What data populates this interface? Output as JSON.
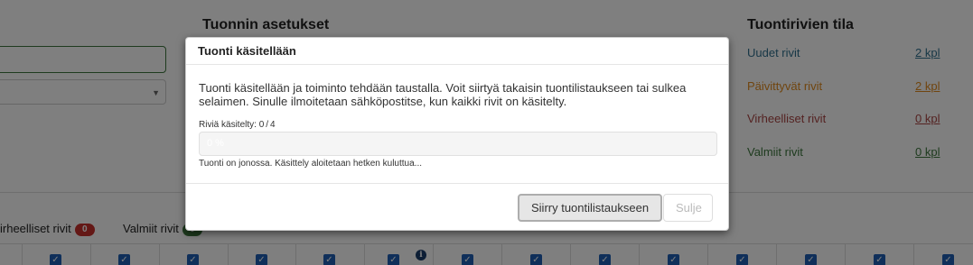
{
  "background": {
    "import_settings_heading": "Tuonnin asetukset",
    "row_status_heading": "Tuontirivien tila",
    "row_status": [
      {
        "label": "Uudet rivit",
        "count": "2 kpl",
        "color": "#31708f"
      },
      {
        "label": "Päivittyvät rivit",
        "count": "2 kpl",
        "color": "#e08a1e"
      },
      {
        "label": "Virheelliset rivit",
        "count": "0 kpl",
        "color": "#a94442"
      },
      {
        "label": "Valmiit rivit",
        "count": "0 kpl",
        "color": "#3c763d"
      }
    ],
    "filters": [
      {
        "label": "irheelliset rivit",
        "badge": "0",
        "badge_color": "#c9302c"
      },
      {
        "label": "Valmiit rivit",
        "badge": "0",
        "badge_color": "#3c763d"
      }
    ]
  },
  "modal": {
    "title": "Tuonti käsitellään",
    "message": "Tuonti käsitellään ja toiminto tehdään taustalla. Voit siirtyä takaisin tuontilistaukseen tai sulkea selaimen. Sinulle ilmoitetaan sähköpostitse, kun kaikki rivit on käsitelty.",
    "progress": {
      "label": "Riviä käsitelty:",
      "processed": "0",
      "total": "4",
      "percent": 0,
      "percent_text": "0 %",
      "bar_color": "#337ab7"
    },
    "queue_note": "Tuonti on jonossa. Käsittely aloitetaan hetken kuluttua...",
    "primary_button": "Siirry tuontilistaukseen",
    "close_button": "Sulje"
  }
}
